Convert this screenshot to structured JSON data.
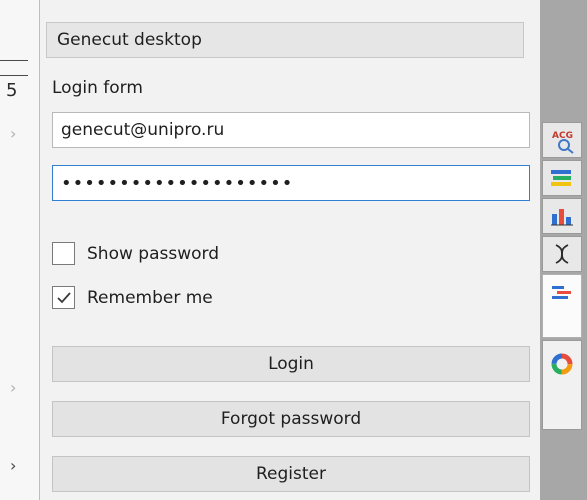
{
  "left_panel": {
    "ruler_number": "5"
  },
  "panel": {
    "title": "Genecut desktop",
    "section_label": "Login form",
    "email": {
      "value": "genecut@unipro.ru"
    },
    "password": {
      "value": "••••••••••••••••••••"
    },
    "show_password": {
      "label": "Show password",
      "checked": false
    },
    "remember_me": {
      "label": "Remember me",
      "checked": true
    },
    "buttons": {
      "login": "Login",
      "forgot": "Forgot password",
      "register": "Register"
    }
  },
  "tabs": [
    {
      "icon": "abc-search-icon",
      "label": "ACG"
    },
    {
      "icon": "layers-icon"
    },
    {
      "icon": "bar-chart-icon"
    },
    {
      "icon": "dna-icon"
    },
    {
      "icon": "alignment-icon",
      "active": true
    },
    {
      "icon": "color-wheel-icon"
    }
  ],
  "colors": {
    "focus_border": "#2f7fd3",
    "tab_strip_bg": "#a7a7a7",
    "panel_bg": "#f2f2f2"
  }
}
